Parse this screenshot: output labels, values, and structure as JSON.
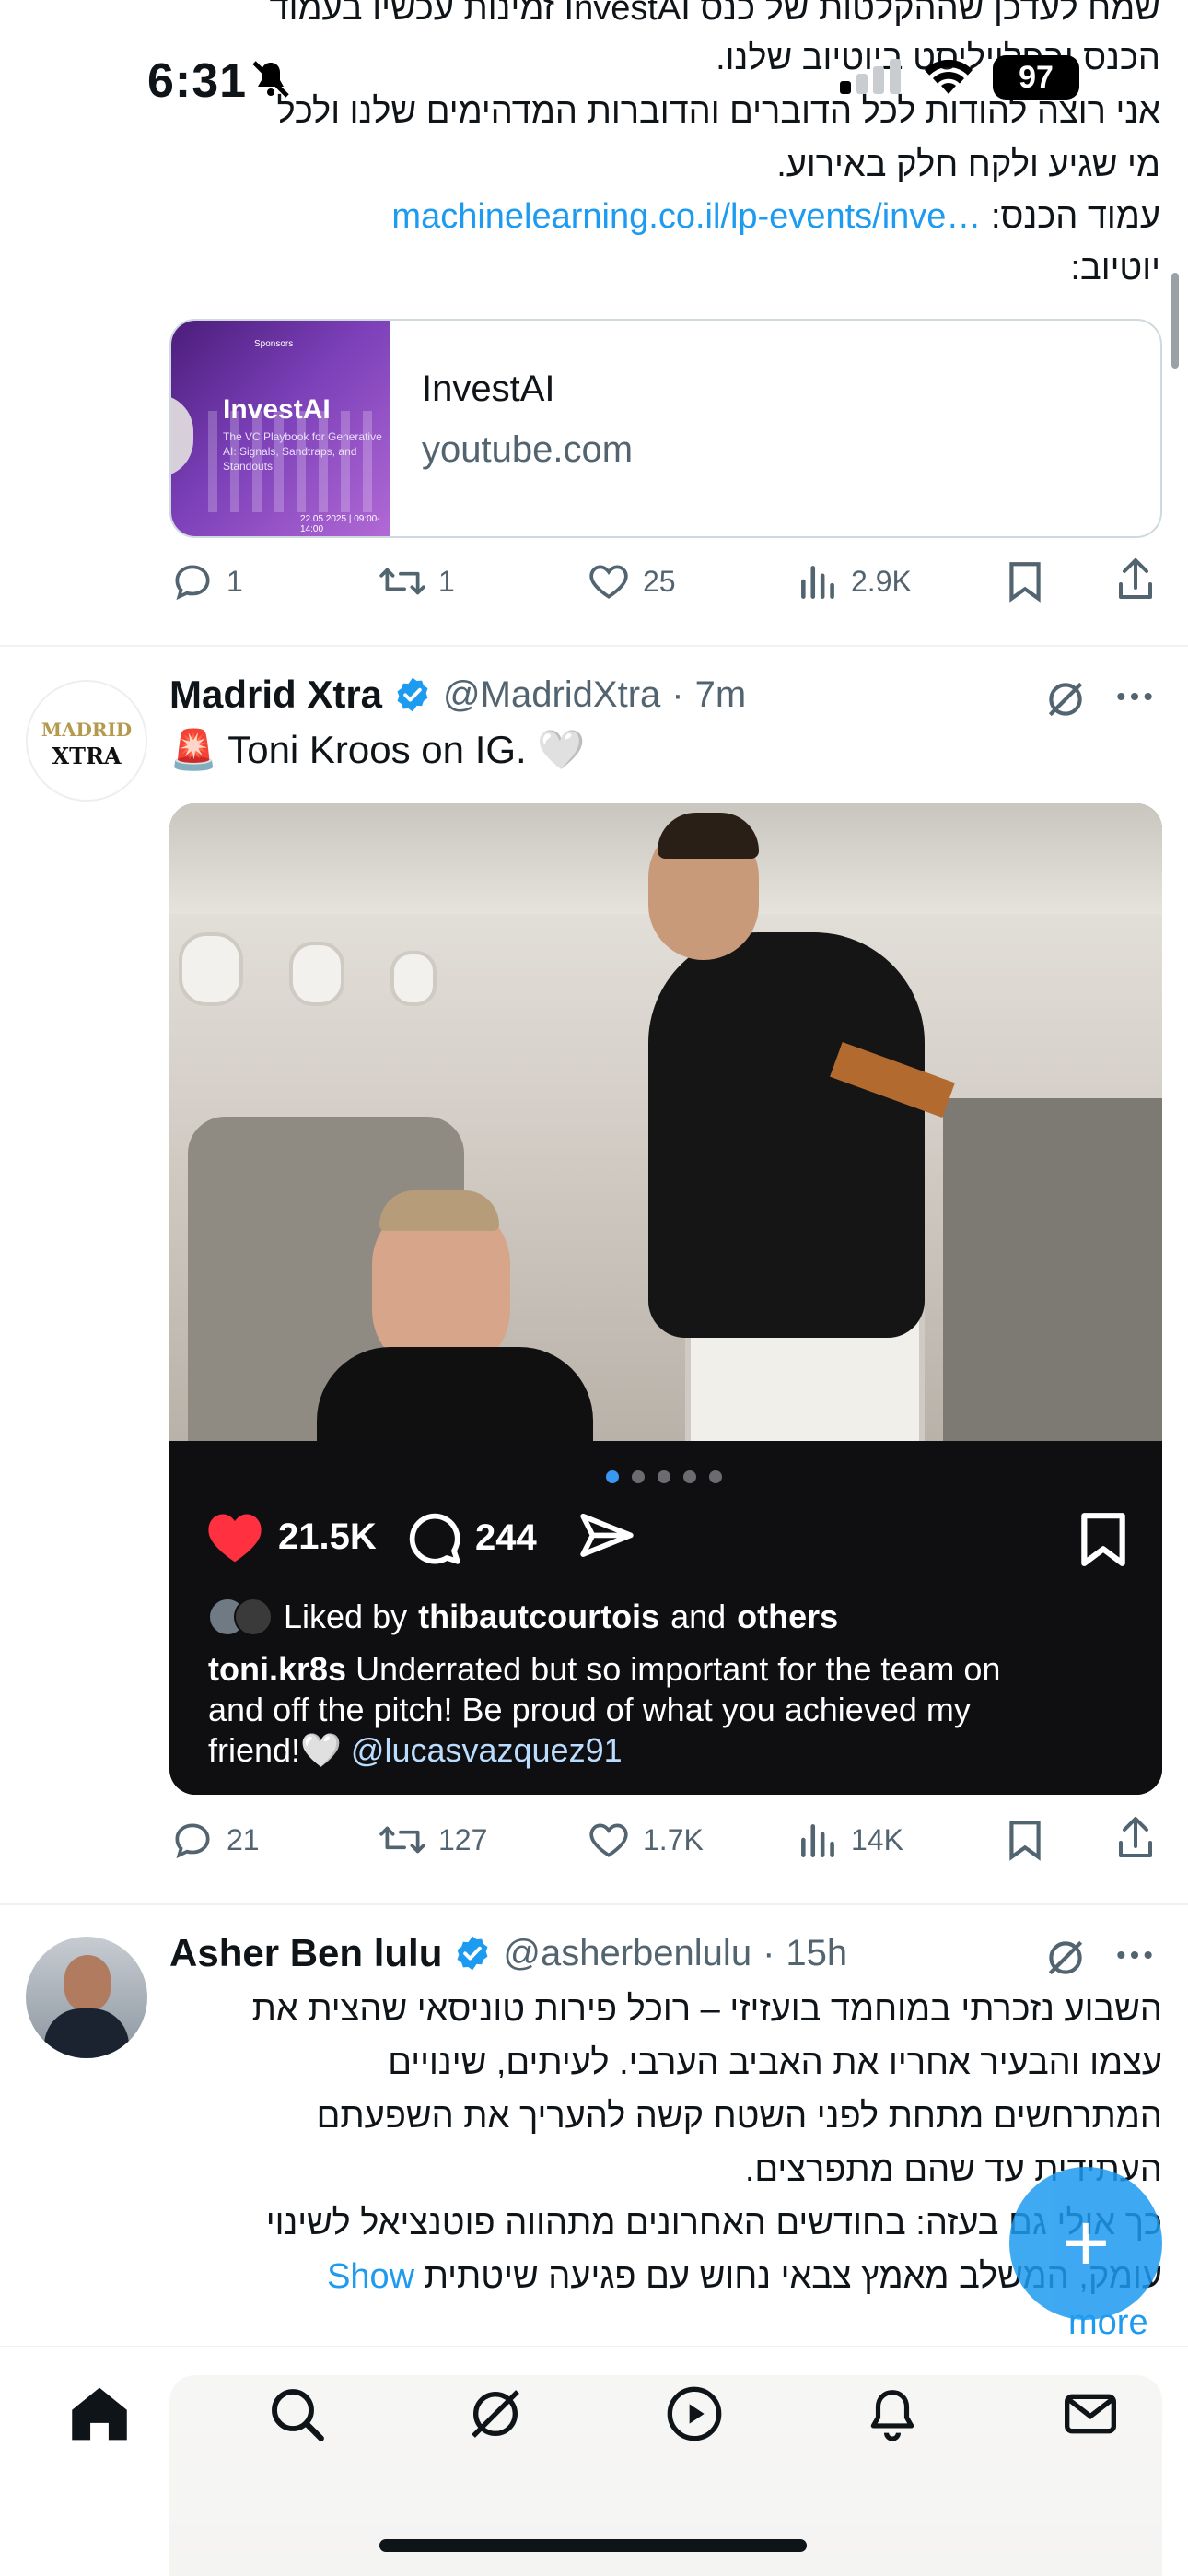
{
  "status": {
    "time": "6:31",
    "battery": "97"
  },
  "tweet1": {
    "lines": [
      "שמח לעדכן שההקלטות של כנס InvestAI זמינות עכשיו בעמוד",
      "הכנס ובפלייליסט ביוטיוב שלנו.",
      "אני רוצה להודות לכל הדוברים והדוברות המדהימים שלנו ולכל",
      "מי שגיע ולקח חלק באירוע."
    ],
    "page_label": "עמוד הכנס:",
    "page_link": "machinelearning.co.il/lp-events/inve…",
    "youtube_label": "יוטיוב:",
    "card": {
      "title": "InvestAI",
      "domain": "youtube.com",
      "thumb_title": "InvestAI",
      "thumb_subtitle": "The VC Playbook for Generative AI: Signals, Sandtraps, and Standouts",
      "thumb_sponsors": "Sponsors",
      "thumb_date": "22.05.2025 | 09:00-14:00"
    },
    "stats": {
      "replies": "1",
      "retweets": "1",
      "likes": "25",
      "views": "2.9K"
    }
  },
  "tweet2": {
    "name": "Madrid Xtra",
    "handle": "@MadridXtra",
    "time": "7m",
    "text": "🚨 Toni Kroos on IG. 🤍",
    "avatar_top": "MADRID",
    "avatar_bottom": "XTRA",
    "ig": {
      "likes": "21.5K",
      "comments": "244",
      "liked_by_prefix": "Liked by",
      "liked_by_user": "thibautcourtois",
      "liked_by_and": "and",
      "liked_by_others": "others",
      "caption_user": "toni.kr8s",
      "caption_line1": "Underrated but so important for the team on",
      "caption_line2": "and off the pitch! Be proud of what you achieved my",
      "caption_line3": "friend!🤍",
      "caption_mention": "@lucasvazquez91"
    },
    "stats": {
      "replies": "21",
      "retweets": "127",
      "likes": "1.7K",
      "views": "14K"
    }
  },
  "tweet3": {
    "name": "Asher Ben lulu",
    "handle": "@asherbenlulu",
    "time": "15h",
    "lines": [
      "השבוע נזכרתי במוחמד בועזיזי – רוכל פירות טוניסאי שהצית את",
      "עצמו והבעיר אחריו את האביב הערבי. לעיתים, שינויים",
      "המתרחשים מתחת לפני השטח קשה להעריך את השפעתם",
      "העתידית עד שהם מתפרצים.",
      "כך אולי גם בעזה: בחודשים האחרונים מתהווה פוטנציאל לשינוי",
      "עומק, המשלב מאמץ צבאי נחוש עם פגיעה שיטתית"
    ],
    "show_more_1": "Show",
    "show_more_2": "more"
  },
  "fab_label": "+",
  "colors": {
    "accent": "#1d9bf0",
    "text": "#0f1419",
    "muted": "#536471",
    "like_red": "#f91880"
  }
}
